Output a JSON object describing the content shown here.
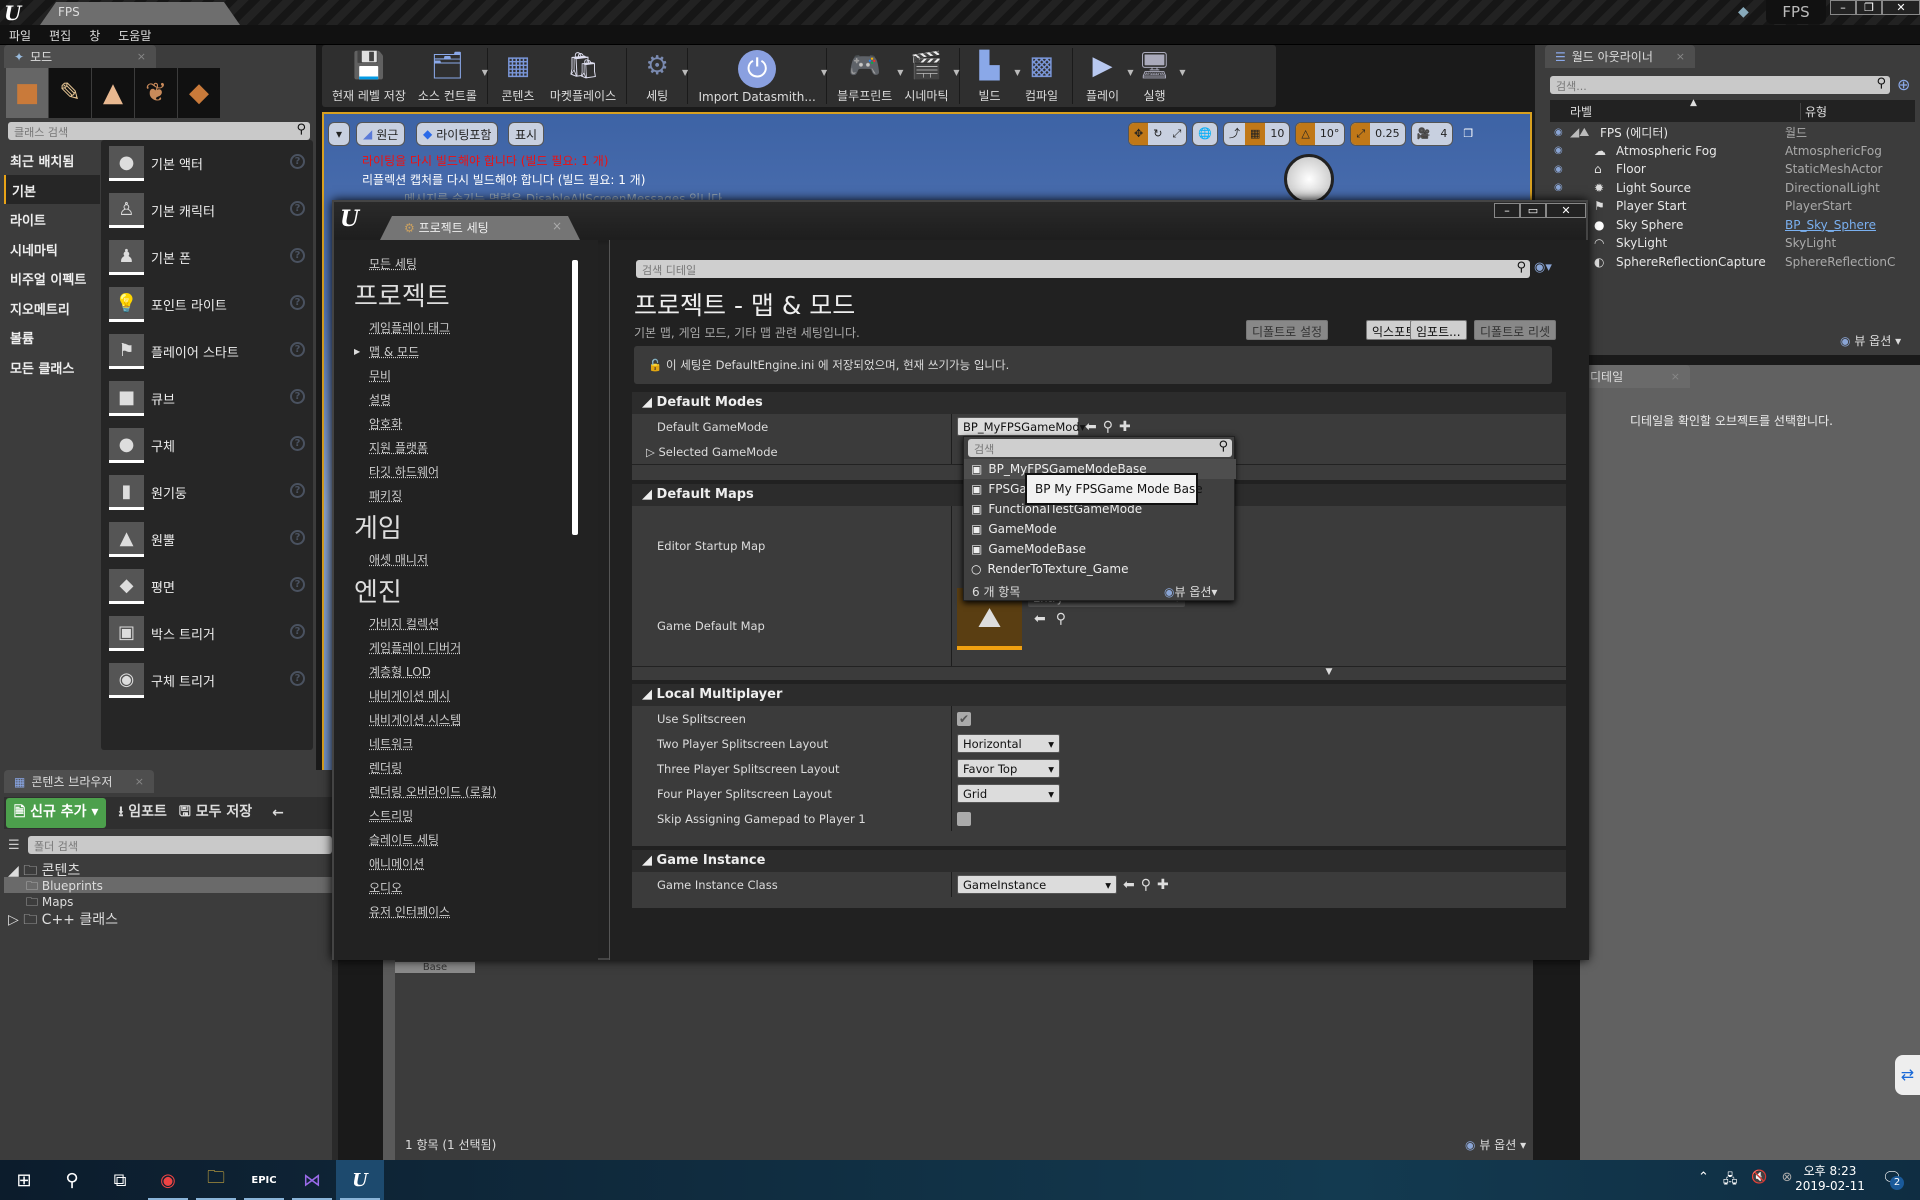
{
  "titlebar": {
    "tab": "FPS",
    "project": "FPS"
  },
  "menu": [
    "파일",
    "편집",
    "창",
    "도움말"
  ],
  "modes": {
    "tab": "모드",
    "search_placeholder": "클래스 검색",
    "categories": [
      "최근 배치됨",
      "기본",
      "라이트",
      "시네마틱",
      "비주얼 이펙트",
      "지오메트리",
      "볼륨",
      "모든 클래스"
    ],
    "selected_category": "기본",
    "items": [
      "기본 액터",
      "기본 캐릭터",
      "기본 폰",
      "포인트 라이트",
      "플레이어 스타트",
      "큐브",
      "구체",
      "원기둥",
      "원뿔",
      "평면",
      "박스 트리거",
      "구체 트리거"
    ]
  },
  "toolbar": [
    "현재 레벨 저장",
    "소스 컨트롤",
    "콘텐츠",
    "마켓플레이스",
    "세팅",
    "Import Datasmith...",
    "블루프린트",
    "시네마틱",
    "빌드",
    "컴파일",
    "플레이",
    "실행"
  ],
  "viewport": {
    "buttons": [
      "원근",
      "라이팅포함",
      "표시"
    ],
    "msg_error": "라이팅을 다시 빌드해야 합니다 (빌드 필요: 1 개)",
    "msg_info": "리플렉션 캡처를 다시 빌드해야 합니다 (빌드 필요: 1 개)",
    "msg_faded": "메시지를 숨기는 명령은 DisableAllScreenMessages 입니다",
    "grid_snap": "10",
    "rot_snap": "10°",
    "scale_snap": "0.25",
    "cam_speed": "4"
  },
  "outliner": {
    "tab": "월드 아웃라이너",
    "search_placeholder": "검색...",
    "col_label": "라벨",
    "col_type": "유형",
    "rows": [
      {
        "name": "FPS (에디터)",
        "type": "월드"
      },
      {
        "name": "Atmospheric Fog",
        "type": "AtmosphericFog"
      },
      {
        "name": "Floor",
        "type": "StaticMeshActor"
      },
      {
        "name": "Light Source",
        "type": "DirectionalLight"
      },
      {
        "name": "Player Start",
        "type": "PlayerStart"
      },
      {
        "name": "Sky Sphere",
        "type": "BP_Sky_Sphere"
      },
      {
        "name": "SkyLight",
        "type": "SkyLight"
      },
      {
        "name": "SphereReflectionCapture",
        "type": "SphereReflectionC"
      }
    ],
    "view_options": "뷰 옵션"
  },
  "details": {
    "tab": "디테일",
    "empty": "디테일을 확인할 오브젝트를 선택합니다."
  },
  "content_browser": {
    "tab": "콘텐츠 브라우저",
    "add_new": "신규 추가",
    "import": "임포트",
    "save_all": "모두 저장",
    "folder_search": "폴더 검색",
    "tree": [
      "콘텐츠",
      "Blueprints",
      "Maps",
      "C++ 클래스"
    ],
    "asset_label": "Base",
    "status": "1 항목 (1 선택됨)",
    "view_options": "뷰 옵션"
  },
  "project_settings": {
    "tab": "프로젝트 세팅",
    "all_settings": "모든 세팅",
    "project_header": "프로젝트",
    "project_links": [
      "게임플레이 태그",
      "맵 & 모드",
      "무비",
      "설명",
      "암호화",
      "지원 플랫폼",
      "타깃 하드웨어",
      "패키징"
    ],
    "game_header": "게임",
    "game_links": [
      "애셋 매니저"
    ],
    "engine_header": "엔진",
    "engine_links": [
      "가비지 컬렉션",
      "게임플레이 디버거",
      "계층형 LOD",
      "내비게이션 메시",
      "내비게이션 시스템",
      "네트워크",
      "렌더링",
      "렌더링 오버라이드 (로컬)",
      "스트리밍",
      "슬레이트 세팅",
      "애니메이션",
      "오디오",
      "유저 인터페이스"
    ],
    "search_placeholder": "검색 디테일",
    "title": "프로젝트 - 맵 & 모드",
    "subtitle": "기본 맵, 게임 모드, 기타 맵 관련 세팅입니다.",
    "buttons": [
      "디폴트로 설정",
      "익스포트...",
      "임포트...",
      "디폴트로 리셋"
    ],
    "notice": "이 세팅은 DefaultEngine.ini 에 저장되었으며, 현재 쓰기가능 입니다.",
    "default_modes": {
      "header": "Default Modes",
      "default_gamemode_label": "Default GameMode",
      "default_gamemode_value": "BP_MyFPSGameMod",
      "selected_gamemode_label": "Selected GameMode"
    },
    "default_maps": {
      "header": "Default Maps",
      "editor_startup_label": "Editor Startup Map",
      "game_default_label": "Game Default Map",
      "game_default_value": "Entry"
    },
    "local_multiplayer": {
      "header": "Local Multiplayer",
      "use_splitscreen_label": "Use Splitscreen",
      "use_splitscreen": true,
      "two_label": "Two Player Splitscreen Layout",
      "two_value": "Horizontal",
      "three_label": "Three Player Splitscreen Layout",
      "three_value": "Favor Top",
      "four_label": "Four Player Splitscreen Layout",
      "four_value": "Grid",
      "skip_label": "Skip Assigning Gamepad to Player 1",
      "skip": false
    },
    "game_instance": {
      "header": "Game Instance",
      "class_label": "Game Instance Class",
      "class_value": "GameInstance"
    }
  },
  "dropdown": {
    "search_placeholder": "검색",
    "items": [
      "BP_MyFPSGameModeBase",
      "FPSGameMode",
      "FunctionalTestGameMode",
      "GameMode",
      "GameModeBase",
      "RenderToTexture_Game"
    ],
    "count": "6 개 항목",
    "view_options": "뷰 옵션",
    "tooltip": "BP My FPSGame Mode Base"
  },
  "taskbar": {
    "time": "오후 8:23",
    "date": "2019-02-11",
    "notifications": "2"
  }
}
